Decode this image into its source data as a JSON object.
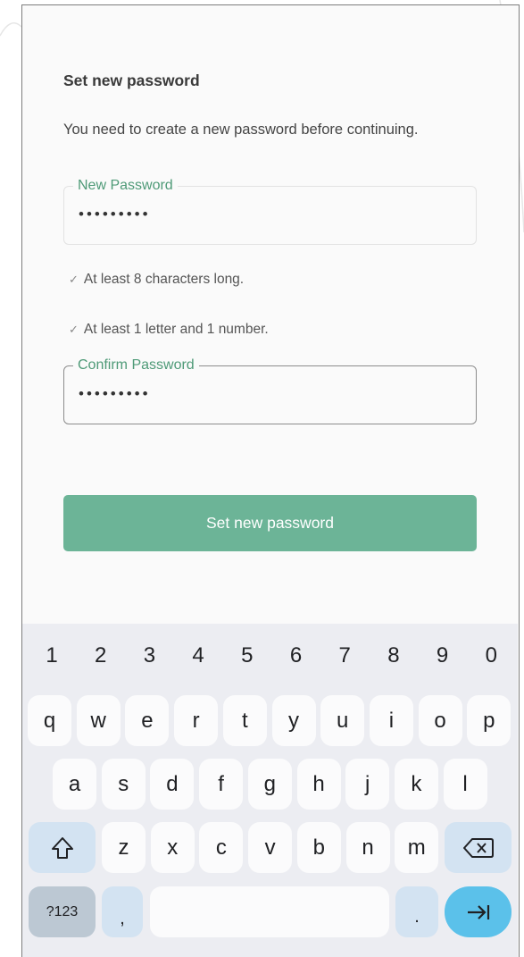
{
  "form": {
    "title": "Set new password",
    "description": "You need to create a new password before continuing.",
    "new_password": {
      "label": "New Password",
      "value": "•••••••••"
    },
    "requirements": [
      {
        "check": "✓",
        "text": "At least 8 characters long."
      },
      {
        "check": "✓",
        "text": "At least 1 letter and 1 number."
      }
    ],
    "confirm_password": {
      "label": "Confirm Password",
      "value": "•••••••••"
    },
    "submit_label": "Set new password"
  },
  "keyboard": {
    "numbers": [
      "1",
      "2",
      "3",
      "4",
      "5",
      "6",
      "7",
      "8",
      "9",
      "0"
    ],
    "row1": [
      "q",
      "w",
      "e",
      "r",
      "t",
      "y",
      "u",
      "i",
      "o",
      "p"
    ],
    "row2": [
      "a",
      "s",
      "d",
      "f",
      "g",
      "h",
      "j",
      "k",
      "l"
    ],
    "row3": [
      "z",
      "x",
      "c",
      "v",
      "b",
      "n",
      "m"
    ],
    "shift_icon": "shift-arrow-icon",
    "backspace_icon": "backspace-icon",
    "symbols_label": "?123",
    "comma_label": ",",
    "period_label": ".",
    "enter_icon": "tab-arrow-icon"
  },
  "colors": {
    "accent_green": "#6cb497",
    "label_green": "#4e9a77",
    "key_fn_blue": "#d3e3f2",
    "enter_blue": "#5bc1ea"
  }
}
